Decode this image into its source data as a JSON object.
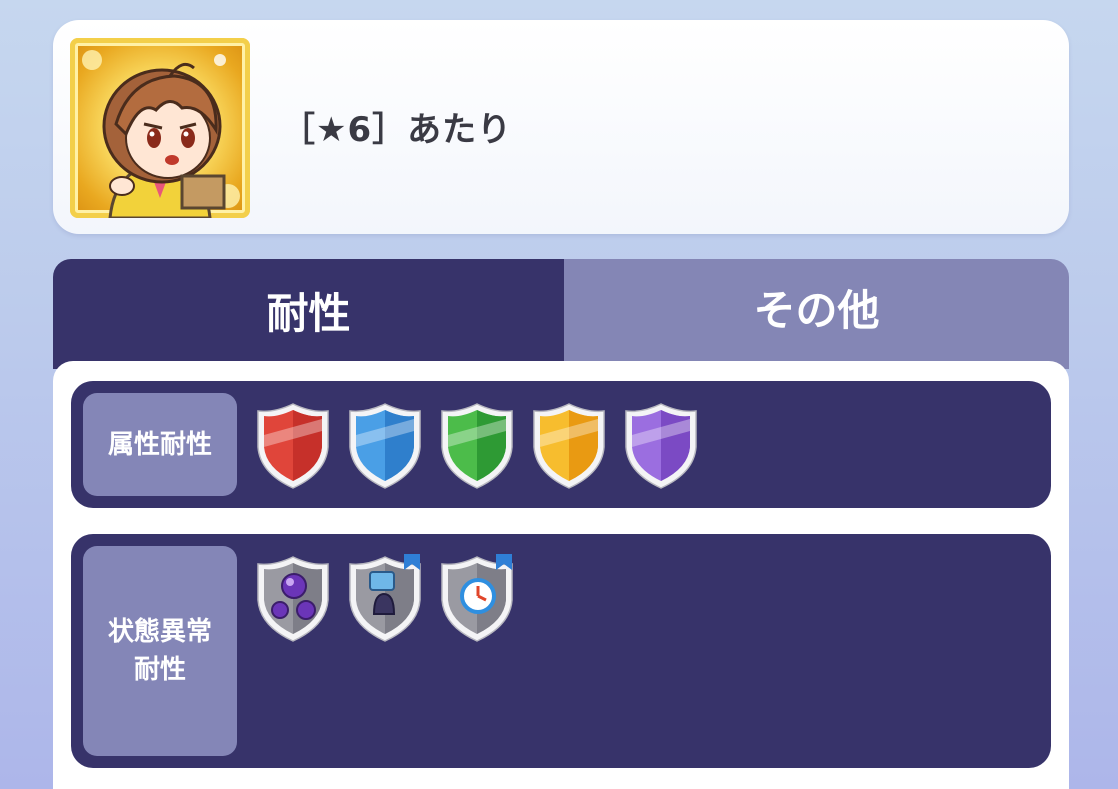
{
  "character": {
    "name": "［★6］あたり",
    "portrait_icon": "character-portrait"
  },
  "tabs": [
    {
      "label": "耐性",
      "active": true
    },
    {
      "label": "その他",
      "active": false
    }
  ],
  "resistance": {
    "attribute": {
      "label": "属性耐性",
      "shields": [
        {
          "name": "red-shield-icon",
          "color": "#e0453a"
        },
        {
          "name": "blue-shield-icon",
          "color": "#3d8fdc"
        },
        {
          "name": "green-shield-icon",
          "color": "#3fae3f"
        },
        {
          "name": "yellow-shield-icon",
          "color": "#f2a91c"
        },
        {
          "name": "purple-shield-icon",
          "color": "#8a5bd0"
        }
      ]
    },
    "status": {
      "label_line1": "状態異常",
      "label_line2": "耐性",
      "shields": [
        {
          "name": "poison-shield-icon"
        },
        {
          "name": "lock-shield-icon"
        },
        {
          "name": "clock-shield-icon"
        }
      ]
    }
  },
  "colors": {
    "panel_dark": "#37336a",
    "panel_light": "#8486b5"
  }
}
